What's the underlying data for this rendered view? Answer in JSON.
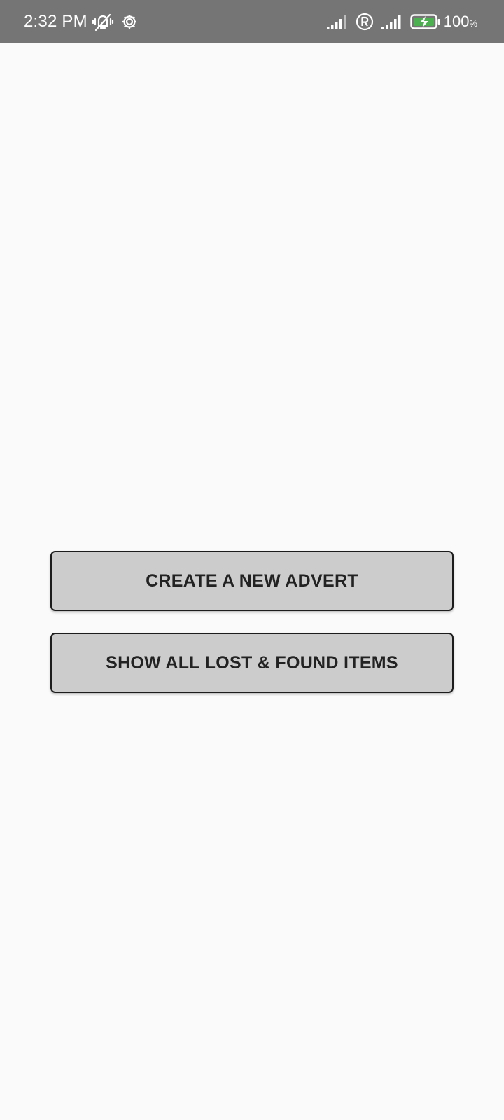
{
  "status_bar": {
    "time": "2:32 PM",
    "battery_value": "100",
    "battery_unit": "%",
    "icons": [
      "vibrate-off-icon",
      "settings-gear-icon",
      "signal-icon",
      "roaming-icon",
      "signal-icon",
      "battery-charging-icon"
    ],
    "battery_color": "#4caf50"
  },
  "main": {
    "create_button_label": "CREATE A NEW ADVERT",
    "show_button_label": "SHOW ALL LOST & FOUND ITEMS"
  },
  "colors": {
    "status_bar_bg": "#757575",
    "page_bg": "#fafafa",
    "button_bg": "#cccccc",
    "button_border": "#1c1c1c",
    "button_text": "#222222"
  }
}
